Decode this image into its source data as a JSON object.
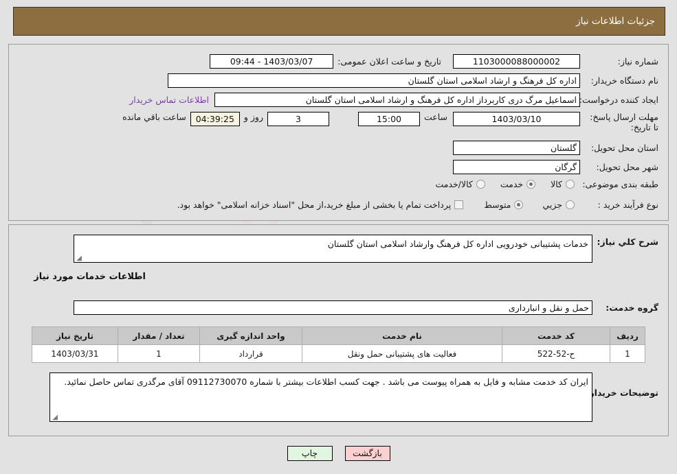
{
  "header": {
    "title": "جزئیات اطلاعات نیاز"
  },
  "form": {
    "need_number_label": "شماره نیاز:",
    "need_number_value": "1103000088000002",
    "announce_datetime_label": "تاریخ و ساعت اعلان عمومی:",
    "announce_datetime_value": "1403/03/07 - 09:44",
    "buyer_org_label": "نام دستگاه خریدار:",
    "buyer_org_value": "اداره کل فرهنگ و ارشاد اسلامی استان گلستان",
    "requester_label": "ایجاد کننده درخواست:",
    "requester_value": "اسماعیل مرگ دری کاربرداز اداره کل فرهنگ و ارشاد اسلامی استان گلستان",
    "contact_link": "اطلاعات تماس خریدار",
    "deadline_label": "مهلت ارسال پاسخ: تا تاریخ:",
    "deadline_date": "1403/03/10",
    "deadline_time_label": "ساعت",
    "deadline_time": "15:00",
    "remaining_days": "3",
    "remaining_days_label": "روز و",
    "remaining_clock": "04:39:25",
    "remaining_clock_label": "ساعت باقي مانده",
    "province_label": "استان محل تحویل:",
    "province_value": "گلستان",
    "city_label": "شهر محل تحویل:",
    "city_value": "گرگان",
    "category_label": "طبقه بندی موضوعی:",
    "category_options": [
      {
        "label": "کالا",
        "selected": false
      },
      {
        "label": "خدمت",
        "selected": true
      },
      {
        "label": "کالا/خدمت",
        "selected": false
      }
    ],
    "process_label": "نوع فرآیند خرید :",
    "process_options": [
      {
        "label": "جزیي",
        "selected": false
      },
      {
        "label": "متوسط",
        "selected": true
      }
    ],
    "treasury_checkbox_label": "پرداخت تمام یا بخشی از مبلغ خرید،از محل \"اسناد خزانه اسلامی\" خواهد بود.",
    "treasury_checked": false
  },
  "description": {
    "general_label": "شرح کلي نیاز:",
    "general_value": "خدمات پشتیبانی خودرویی اداره کل فرهنگ وارشاد اسلامی استان گلستان",
    "section_heading": "اطلاعات خدمات مورد نیاز",
    "service_group_label": "گروه خدمت:",
    "service_group_value": "حمل و نقل و انبارداری",
    "buyer_notes_label": "توضیحات خریدار:",
    "buyer_notes_value": "ایران کد خدمت مشابه و فایل به همراه پیوست می باشد . جهت کسب اطلاعات بیشتر با شماره 09112730070 آقای مرگدری تماس حاصل نمائید."
  },
  "table": {
    "columns": [
      "ردیف",
      "کد خدمت",
      "نام خدمت",
      "واحد اندازه گیری",
      "تعداد / مقدار",
      "تاریخ نیاز"
    ],
    "rows": [
      {
        "row_no": "1",
        "service_code": "ح-52-522",
        "service_name": "فعالیت های پشتیبانی حمل ونقل",
        "unit": "قرارداد",
        "quantity": "1",
        "need_date": "1403/03/31"
      }
    ]
  },
  "footer": {
    "back_label": "بازگشت",
    "print_label": "چاپ"
  },
  "colors": {
    "header_bar": "#8d6e41",
    "page_bg": "#e2e2e2",
    "link": "#7b3fa0",
    "back_button": "#fad0d0",
    "print_button": "#e2f5e0",
    "table_header": "#c9c9c9",
    "countdown_field": "#f6f4e0"
  },
  "watermark": {
    "text": "AnaTender.net"
  }
}
